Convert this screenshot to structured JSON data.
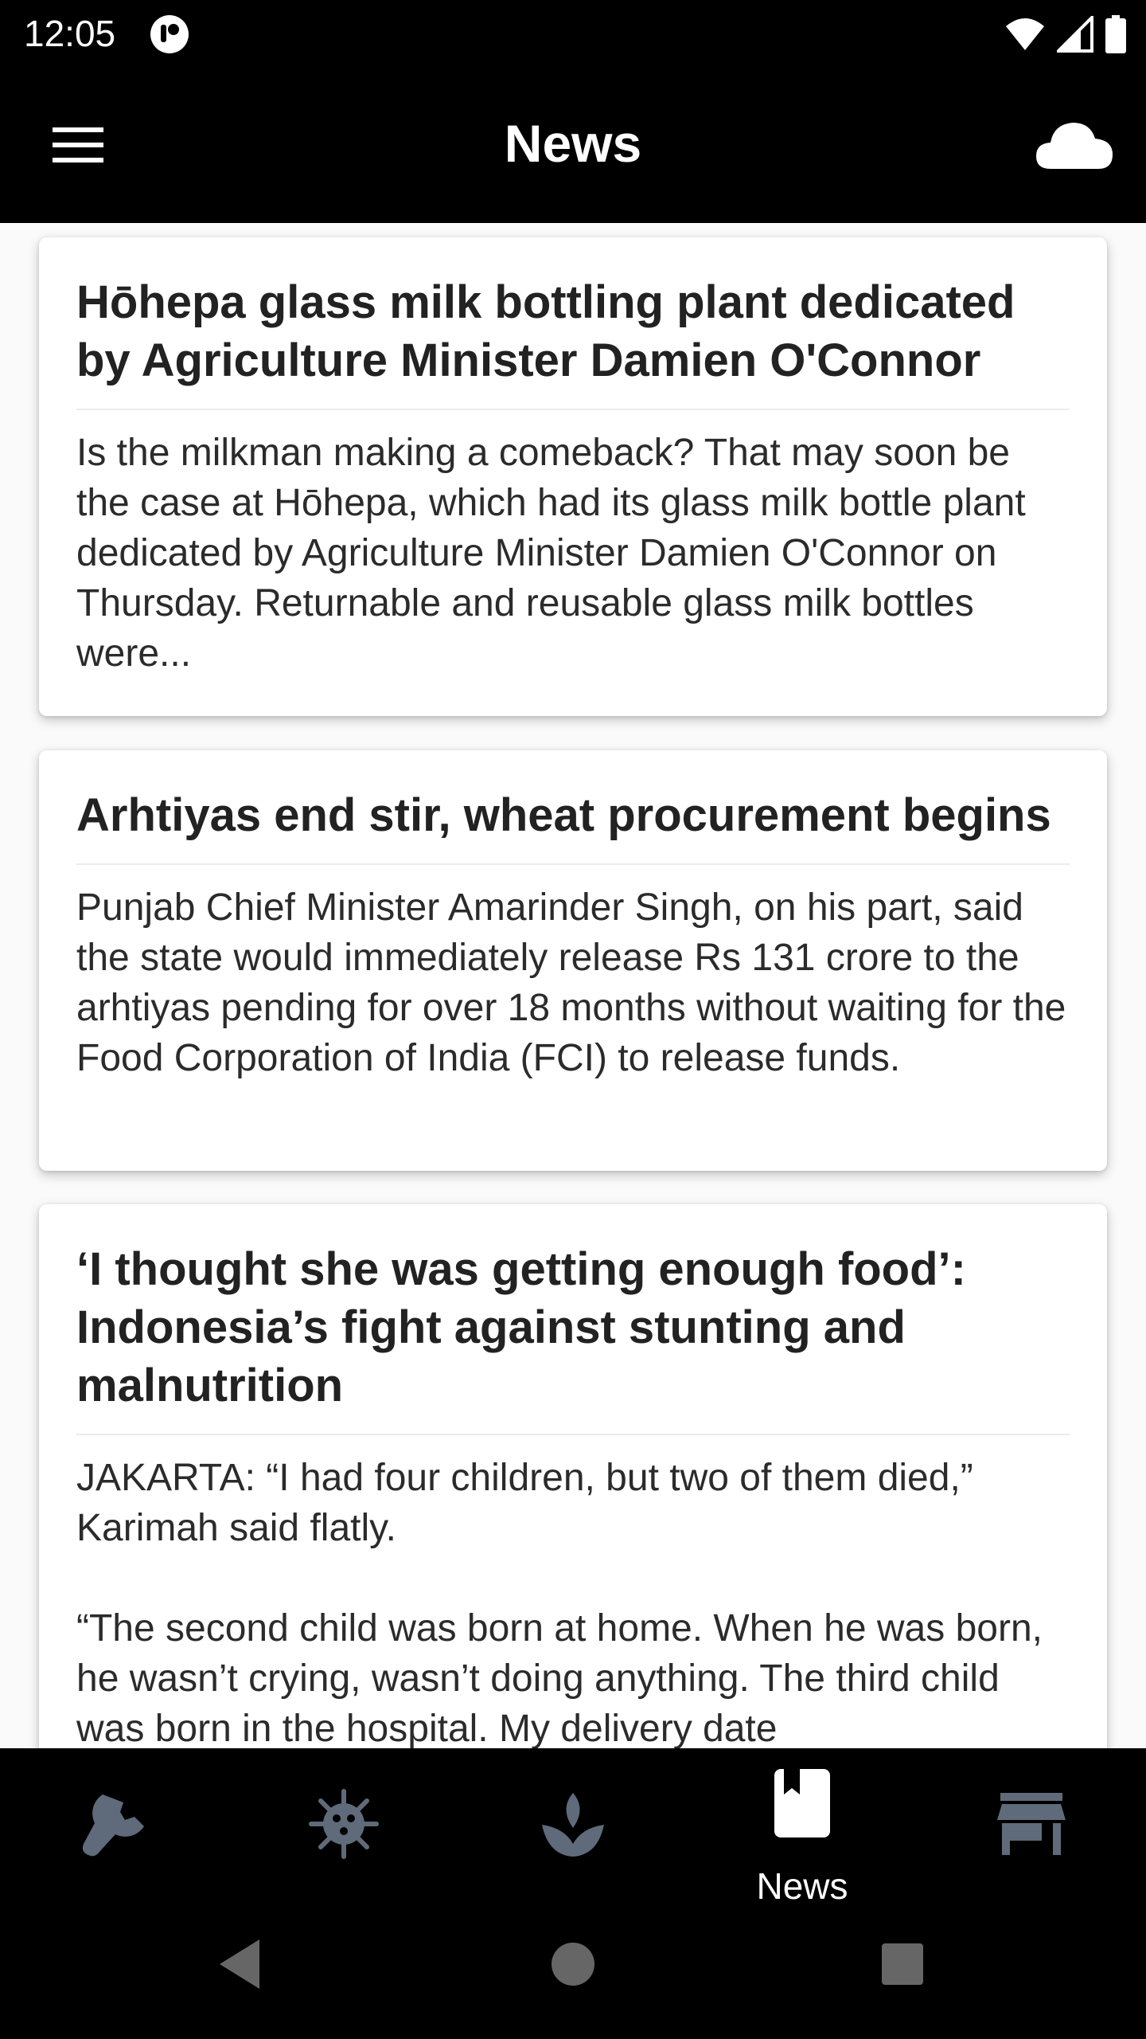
{
  "status_bar": {
    "time": "12:05"
  },
  "app_bar": {
    "title": "News"
  },
  "articles": [
    {
      "title": "Hōhepa glass milk bottling plant dedicated by Agriculture Minister Damien O'Connor",
      "body": "Is the milkman making a comeback? That may soon be the case at Hōhepa, which had its glass milk bottle plant dedicated by Agriculture Minister Damien O'Connor on Thursday. Returnable and reusable glass milk bottles were..."
    },
    {
      "title": "Arhtiyas end stir, wheat procurement begins",
      "body": "Punjab Chief Minister Amarinder Singh, on his part, said the state would immediately release Rs 131 crore to the arhtiyas pending for over 18 months without waiting for the Food Corporation of India (FCI) to release funds."
    },
    {
      "title": "‘I thought she was getting enough food’: Indonesia’s fight against stunting and malnutrition",
      "body": "JAKARTA: “I had four children, but two of them died,” Karimah said flatly.\n\n“The second child was born at home. When he was born, he wasn’t crying, wasn’t doing anything. The third child was born in the hospital. My delivery date"
    }
  ],
  "bottom_nav": {
    "items": [
      {
        "icon": "wrench-icon",
        "label": ""
      },
      {
        "icon": "virus-icon",
        "label": ""
      },
      {
        "icon": "sprout-icon",
        "label": ""
      },
      {
        "icon": "news-book-icon",
        "label": "News",
        "active": true
      },
      {
        "icon": "store-icon",
        "label": ""
      }
    ]
  },
  "colors": {
    "active": "#ffffff",
    "inactive": "#5f6b7a",
    "content_bg": "#fafafa"
  }
}
